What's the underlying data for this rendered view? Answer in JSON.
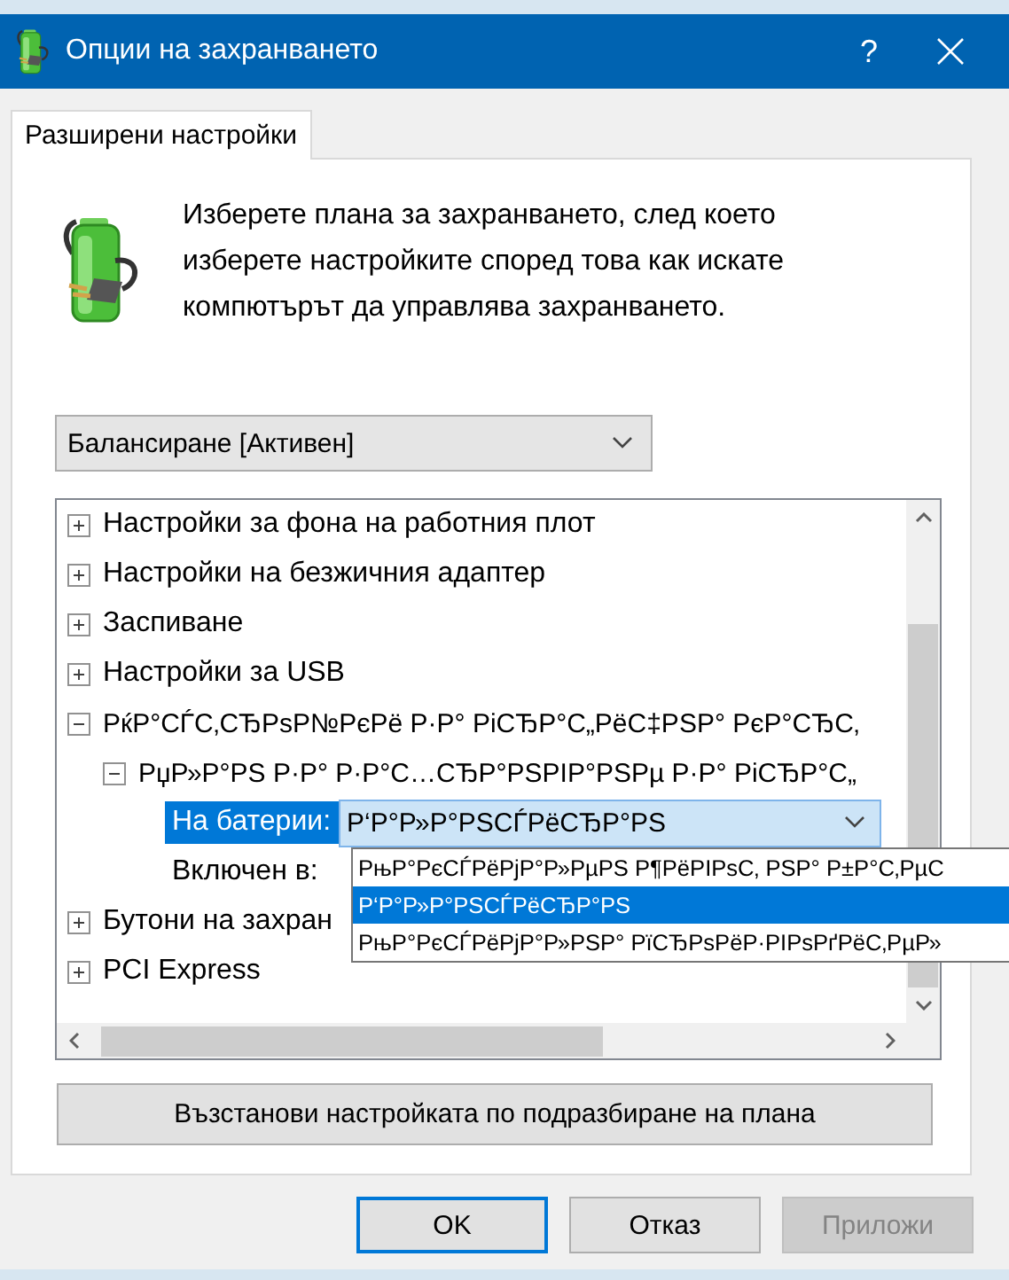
{
  "window": {
    "title": "Опции на захранването",
    "help_button": "?"
  },
  "tabs": [
    {
      "label": "Разширени настройки",
      "selected": true
    }
  ],
  "description": "Изберете плана за захранването, след което изберете настройките според това как искате компютърът да управлява захранването.",
  "plan_select": {
    "value": "Балансиране [Активен]"
  },
  "tree": {
    "items": [
      {
        "label": "Настройки за фона на работния плот",
        "expanded": false
      },
      {
        "label": "Настройки на безжичния адаптер",
        "expanded": false
      },
      {
        "label": "Заспиване",
        "expanded": false
      },
      {
        "label": "Настройки за USB",
        "expanded": false
      },
      {
        "label": "РќР°СЃС‚СЂРѕР№РєРё Р·Р° РіСЂР°С„РёС‡РЅР° РєР°СЂС‚",
        "expanded": true,
        "children": [
          {
            "label": "РџР»Р°РЅ Р·Р° Р·Р°С…СЂР°РЅРІР°РЅРµ Р·Р° РіСЂР°С„",
            "expanded": true,
            "children": [
              {
                "kind": "setting",
                "label": "На батерии:",
                "value": "Р‘Р°Р»Р°РЅСЃРёСЂР°РЅ",
                "selected": true
              },
              {
                "kind": "setting",
                "label": "Включен в:",
                "selected": false
              }
            ]
          }
        ]
      },
      {
        "label": "Бутони на захран",
        "expanded": false
      },
      {
        "label": "PCI Express",
        "expanded": false
      }
    ]
  },
  "dropdown": {
    "options": [
      {
        "label": "РњР°РєСЃРёРјР°Р»РµРЅ Р¶РёРІРѕС‚ РЅР° Р±Р°С‚РµС",
        "selected": false
      },
      {
        "label": "Р‘Р°Р»Р°РЅСЃРёСЂР°РЅ",
        "selected": true
      },
      {
        "label": "РњР°РєСЃРёРјР°Р»РЅР° РїСЂРѕРёР·РІРѕРґРёС‚РµР»",
        "selected": false
      }
    ]
  },
  "restore_button": "Възстанови настройката по подразбиране на плана",
  "buttons": [
    {
      "label": "OK",
      "default": true,
      "disabled": false
    },
    {
      "label": "Отказ",
      "default": false,
      "disabled": false
    },
    {
      "label": "Приложи",
      "default": false,
      "disabled": true
    }
  ]
}
